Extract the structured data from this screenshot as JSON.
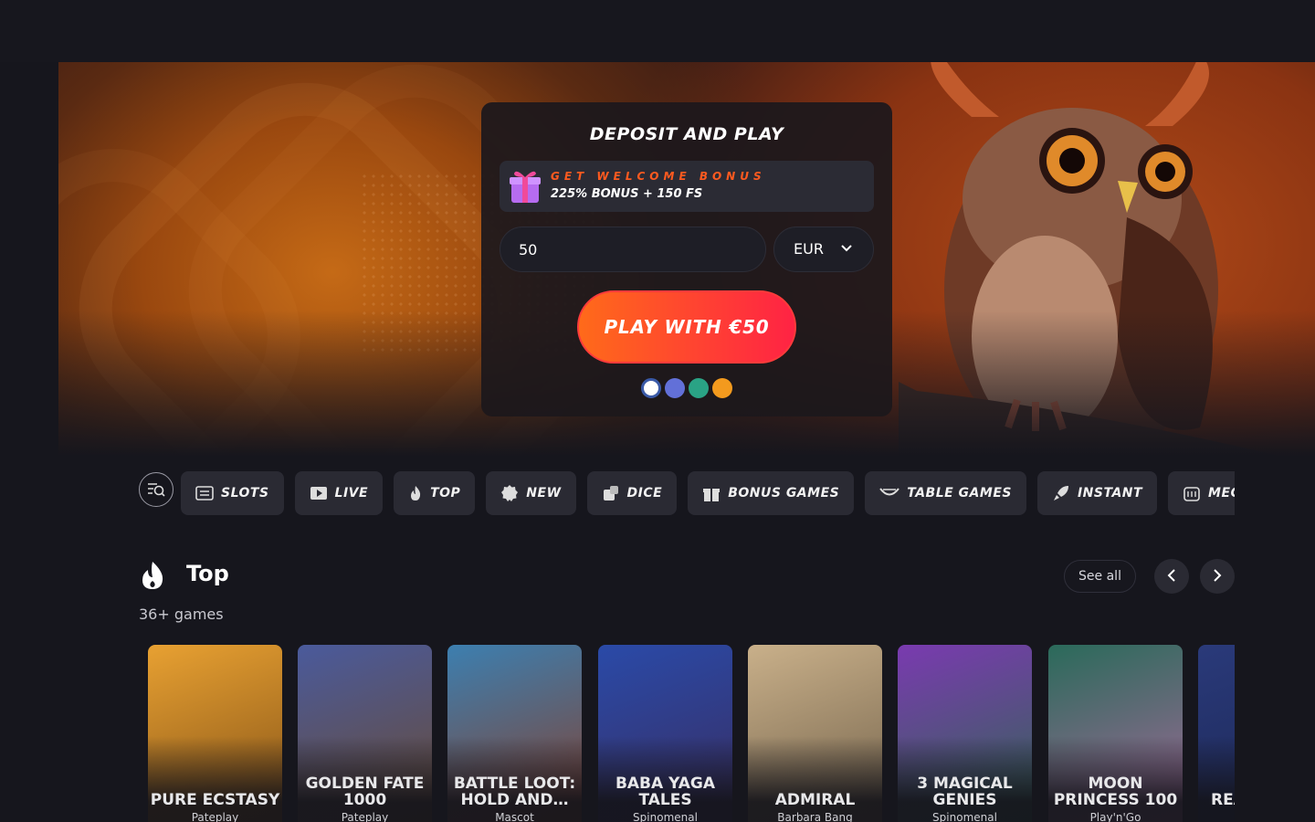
{
  "deposit": {
    "title": "DEPOSIT AND PLAY",
    "bonus_label": "GET WELCOME BONUS",
    "bonus_value": "225% BONUS + 150 FS",
    "amount": "50",
    "currency": "EUR",
    "play_button": "PLAY WITH €50",
    "payment_methods": [
      "bank-icon",
      "ethereum-icon",
      "tether-icon",
      "bitcoin-icon"
    ]
  },
  "categories": [
    {
      "label": "SLOTS",
      "icon": "slots-icon"
    },
    {
      "label": "LIVE",
      "icon": "live-icon"
    },
    {
      "label": "TOP",
      "icon": "fire-icon"
    },
    {
      "label": "NEW",
      "icon": "new-icon"
    },
    {
      "label": "DICE",
      "icon": "dice-icon"
    },
    {
      "label": "BONUS GAMES",
      "icon": "gift-icon"
    },
    {
      "label": "TABLE GAMES",
      "icon": "table-icon"
    },
    {
      "label": "INSTANT",
      "icon": "rocket-icon"
    },
    {
      "label": "MEGAWAYS",
      "icon": "megaways-icon"
    }
  ],
  "section": {
    "title": "Top",
    "subtitle": "36+ games",
    "see_all": "See all"
  },
  "games": [
    {
      "name": "PURE ECSTASY",
      "provider": "Pateplay",
      "colors": [
        "#e8a132",
        "#7a4a14"
      ]
    },
    {
      "name": "GOLDEN FATE 1000",
      "provider": "Pateplay",
      "colors": [
        "#4a5a9c",
        "#6b4a2a"
      ]
    },
    {
      "name": "BATTLE LOOT: HOLD AND…",
      "provider": "Mascot",
      "colors": [
        "#3c7fb0",
        "#8a3a22"
      ]
    },
    {
      "name": "BABA YAGA TALES",
      "provider": "Spinomenal",
      "colors": [
        "#2a4aa8",
        "#3a2a5a"
      ]
    },
    {
      "name": "ADMIRAL",
      "provider": "Barbara Bang",
      "colors": [
        "#c9b08a",
        "#6a5a44"
      ]
    },
    {
      "name": "3 MAGICAL GENIES",
      "provider": "Spinomenal",
      "colors": [
        "#7a3ab0",
        "#2a6a4a"
      ]
    },
    {
      "name": "MOON PRINCESS 100",
      "provider": "Play'n'Go",
      "colors": [
        "#2a6a5a",
        "#b06aa0"
      ]
    },
    {
      "name": "REALM",
      "provider": "",
      "colors": [
        "#2a3a7a",
        "#1a2450"
      ]
    }
  ]
}
